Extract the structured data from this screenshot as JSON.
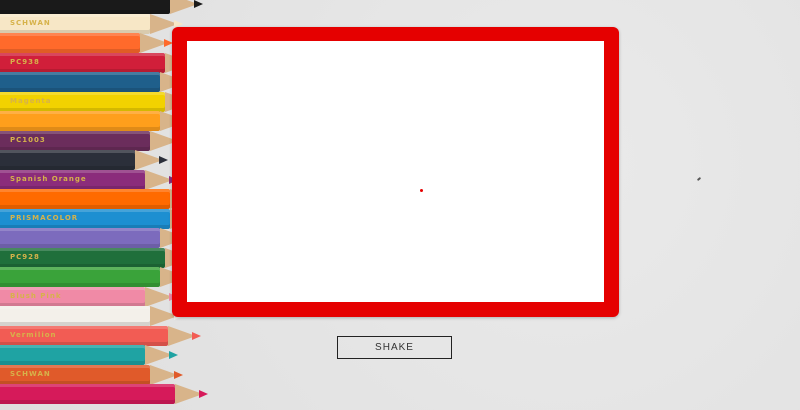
{
  "scene": {
    "background_color": "#e6e6e6",
    "decorative_image": "colored-pencils",
    "pencil_colors": [
      "#1a1a1a",
      "#f7e7c6",
      "#ff6a2b",
      "#d11f3a",
      "#1f5f8b",
      "#f2d200",
      "#ff9f1c",
      "#6b2d5c",
      "#2b2f3a",
      "#8b2c7b",
      "#ff6a00",
      "#1d8fd1",
      "#7c6bbd",
      "#1f6f3b",
      "#3aa33a",
      "#f08aa6",
      "#f3f0ea",
      "#f25c54",
      "#1fa3a3",
      "#e05a2a",
      "#d61a5a"
    ],
    "pencil_stamps": [
      "SCHWAN",
      "PC938",
      "Magenta",
      "PC1003",
      "Spanish Orange",
      "PRISMACOLOR",
      "PC928",
      "Blush Pink",
      "Vermilion"
    ]
  },
  "etch_sketch": {
    "frame_color": "#e50000",
    "screen_color": "#ffffff",
    "cursor_color": "#e50000"
  },
  "controls": {
    "shake_label": "SHAKE"
  }
}
